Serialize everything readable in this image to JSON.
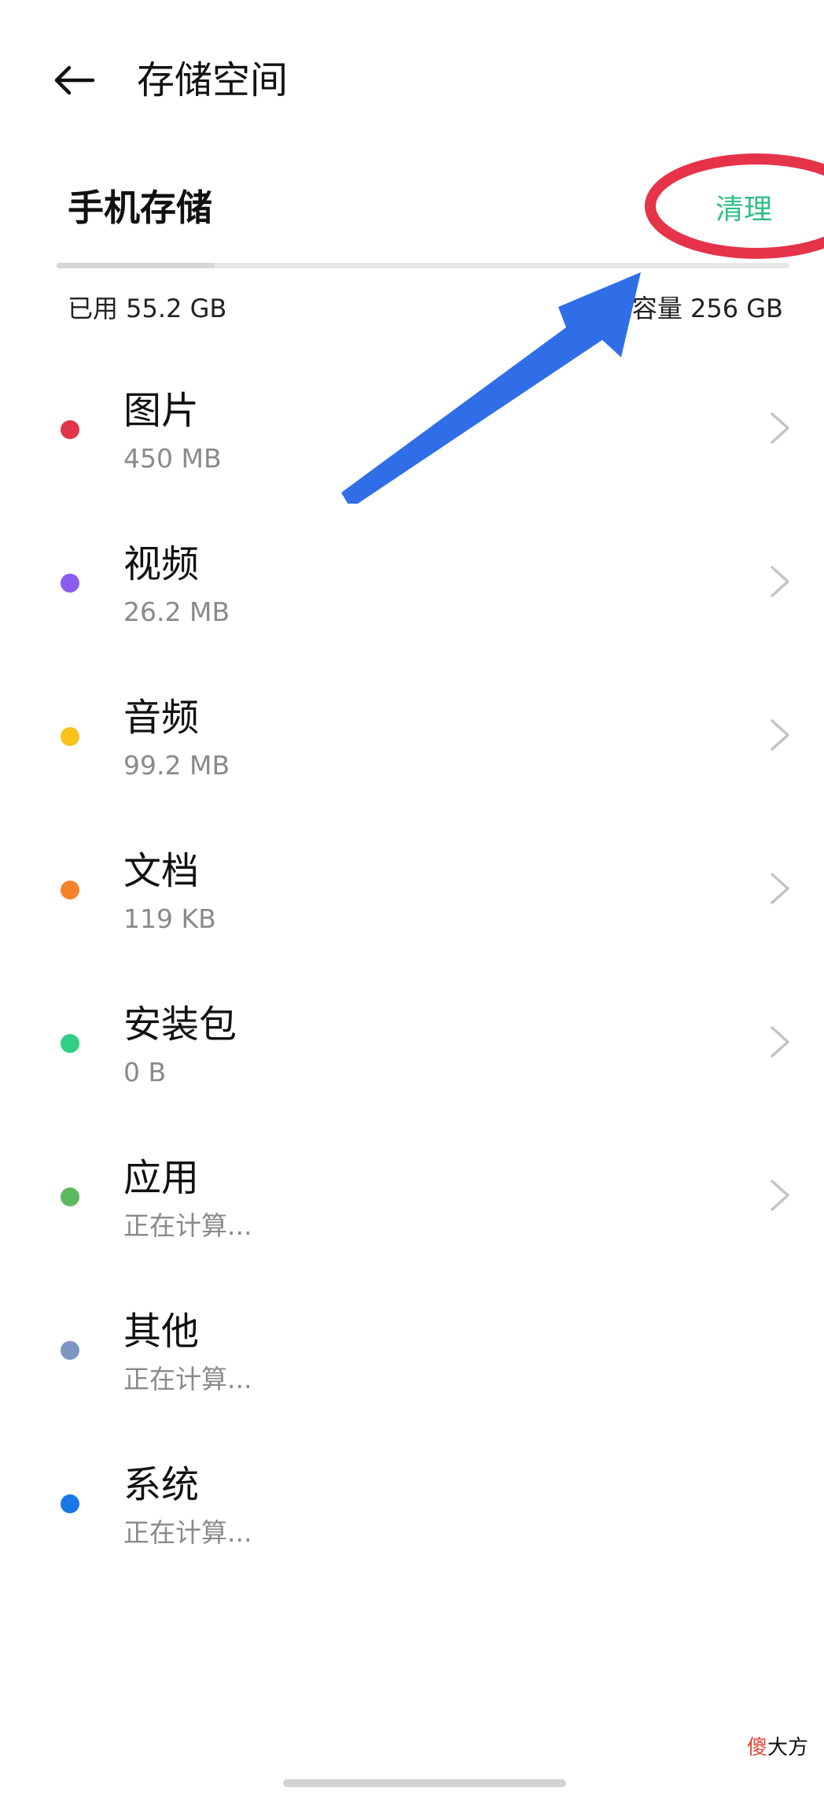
{
  "header": {
    "back_icon": "arrow-left-icon",
    "title": "存储空间"
  },
  "phone_storage": {
    "title": "手机存储",
    "clean_label": "清理",
    "clean_color": "#2fbf84",
    "used_label": "已用 55.2 GB",
    "total_label": "总容量 256 GB",
    "used_fraction": 0.2156
  },
  "items": [
    {
      "name": "图片",
      "size": "450 MB",
      "color": "#e0364a",
      "has_chevron": true
    },
    {
      "name": "视频",
      "size": "26.2 MB",
      "color": "#8b5cf0",
      "has_chevron": true
    },
    {
      "name": "音频",
      "size": "99.2 MB",
      "color": "#f7c21c",
      "has_chevron": true
    },
    {
      "name": "文档",
      "size": "119 KB",
      "color": "#f5822a",
      "has_chevron": true
    },
    {
      "name": "安装包",
      "size": "0 B",
      "color": "#2fcf85",
      "has_chevron": true
    },
    {
      "name": "应用",
      "size": "正在计算...",
      "color": "#5cb85c",
      "has_chevron": true
    },
    {
      "name": "其他",
      "size": "正在计算...",
      "color": "#7f96c2",
      "has_chevron": false
    },
    {
      "name": "系统",
      "size": "正在计算...",
      "color": "#1976e6",
      "has_chevron": false
    }
  ],
  "icons": {
    "chevron": "chevron-right-icon"
  },
  "annotations": {
    "ellipse_color": "#e5334a",
    "arrow_color": "#2f6ee6"
  },
  "watermark": {
    "accent": "傻",
    "rest": "大方"
  }
}
